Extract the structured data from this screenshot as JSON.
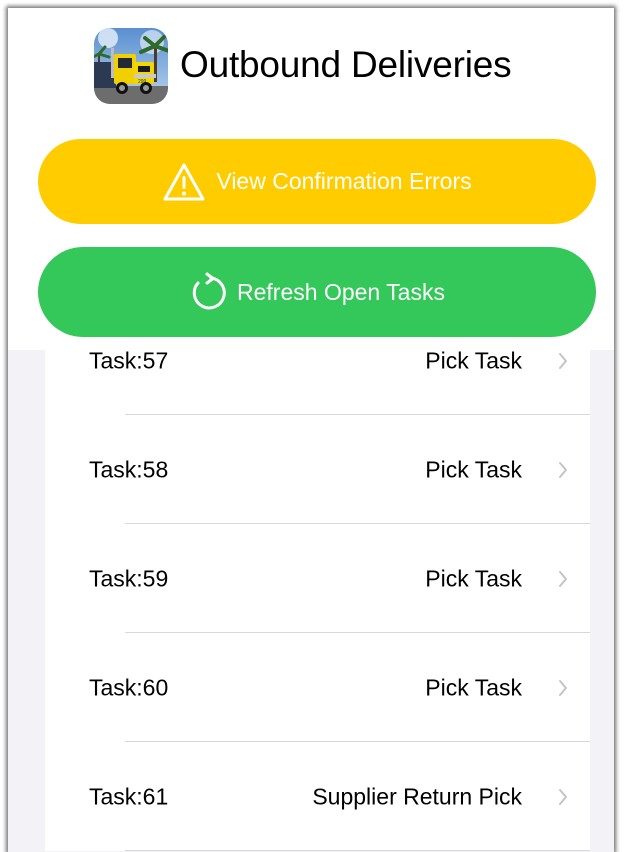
{
  "header": {
    "title": "Outbound Deliveries",
    "logo_icon": "yellow-truck-app-icon"
  },
  "actions": {
    "errors_label": "View Confirmation Errors",
    "errors_icon": "warning-triangle-icon",
    "errors_color": "#ffcc00",
    "refresh_label": "Refresh Open Tasks",
    "refresh_icon": "refresh-icon",
    "refresh_color": "#34c759"
  },
  "tasks": [
    {
      "id": "Task:57",
      "type": "Pick Task"
    },
    {
      "id": "Task:58",
      "type": "Pick Task"
    },
    {
      "id": "Task:59",
      "type": "Pick Task"
    },
    {
      "id": "Task:60",
      "type": "Pick Task"
    },
    {
      "id": "Task:61",
      "type": "Supplier Return Pick"
    }
  ]
}
